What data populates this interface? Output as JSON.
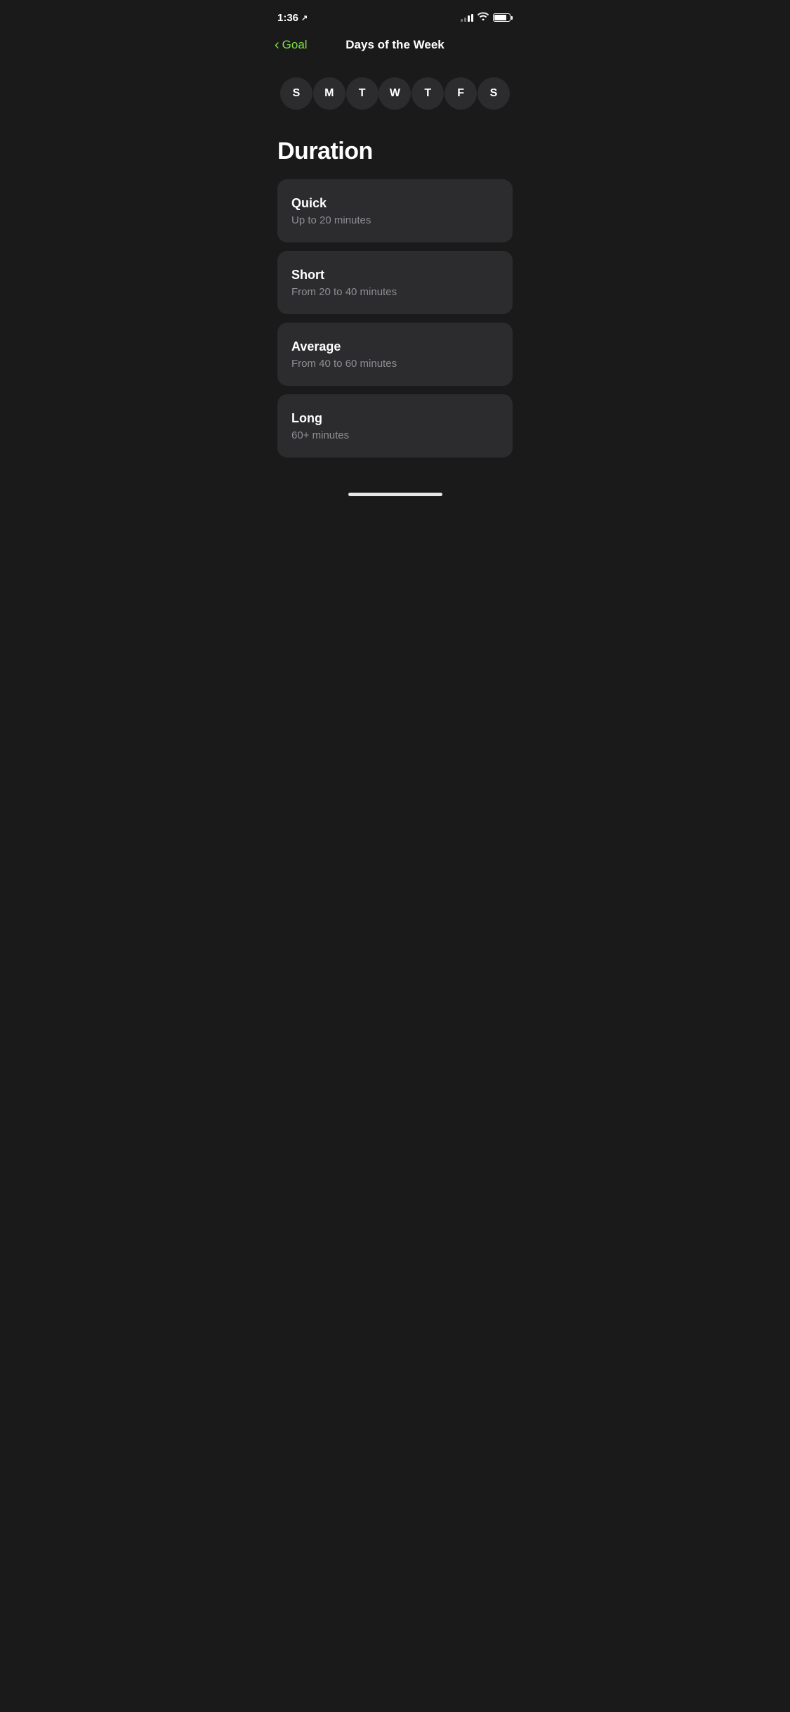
{
  "statusBar": {
    "time": "1:36",
    "locationIcon": "✈",
    "signalBars": [
      3,
      5,
      7,
      9,
      11
    ],
    "batteryPercent": 80
  },
  "navigation": {
    "backLabel": "Goal",
    "title": "Days of the Week"
  },
  "days": [
    {
      "label": "S",
      "id": "sunday"
    },
    {
      "label": "M",
      "id": "monday"
    },
    {
      "label": "T",
      "id": "tuesday"
    },
    {
      "label": "W",
      "id": "wednesday"
    },
    {
      "label": "T",
      "id": "thursday"
    },
    {
      "label": "F",
      "id": "friday"
    },
    {
      "label": "S",
      "id": "saturday"
    }
  ],
  "durationSection": {
    "heading": "Duration"
  },
  "durationCards": [
    {
      "id": "quick",
      "title": "Quick",
      "subtitle": "Up to 20 minutes"
    },
    {
      "id": "short",
      "title": "Short",
      "subtitle": "From 20 to 40 minutes"
    },
    {
      "id": "average",
      "title": "Average",
      "subtitle": "From 40 to 60 minutes"
    },
    {
      "id": "long",
      "title": "Long",
      "subtitle": "60+ minutes"
    }
  ],
  "colors": {
    "accent": "#7de047",
    "background": "#1a1a1a",
    "cardBackground": "#2c2c2e",
    "textPrimary": "#ffffff",
    "textSecondary": "#8e8e93"
  }
}
